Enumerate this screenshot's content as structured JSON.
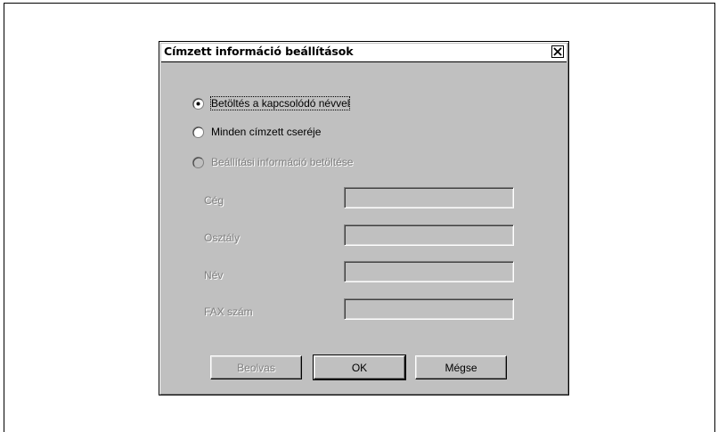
{
  "dialog": {
    "title": "Címzett információ beállítások",
    "options": [
      {
        "label": "Betöltés a kapcsolódó névvel",
        "checked": true,
        "enabled": true
      },
      {
        "label": "Minden címzett cseréje",
        "checked": false,
        "enabled": true
      },
      {
        "label": "Beállítási információ betöltése",
        "checked": false,
        "enabled": false
      }
    ],
    "fields": [
      {
        "label": "Cég",
        "value": ""
      },
      {
        "label": "Osztály",
        "value": ""
      },
      {
        "label": "Név",
        "value": ""
      },
      {
        "label": "FAX szám",
        "value": ""
      }
    ],
    "buttons": {
      "insert": "Beolvas",
      "ok": "OK",
      "cancel": "Mégse"
    }
  },
  "icons": {
    "close": "close-icon",
    "radio_checked": "radio-checked-icon",
    "radio_unchecked": "radio-unchecked-icon",
    "radio_disabled": "radio-disabled-icon"
  },
  "colors": {
    "dialog_bg": "#c0c0c0",
    "disabled_text": "#808080"
  }
}
